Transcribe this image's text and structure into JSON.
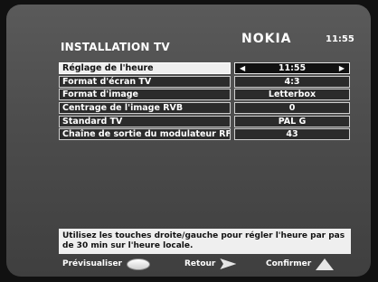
{
  "header": {
    "title": "INSTALLATION TV",
    "brand": "NOKIA",
    "time": "11:55"
  },
  "menu": {
    "rows": [
      {
        "label": "Réglage de l'heure",
        "value": "11:55",
        "selected": true
      },
      {
        "label": "Format d'écran TV",
        "value": "4:3"
      },
      {
        "label": "Format d'image",
        "value": "Letterbox"
      },
      {
        "label": "Centrage de l'image RVB",
        "value": "0"
      },
      {
        "label": "Standard TV",
        "value": "PAL G"
      },
      {
        "label": "Chaîne de sortie du modulateur RF",
        "value": "43"
      }
    ],
    "left_arrow": "◀",
    "right_arrow": "▶"
  },
  "help": {
    "text": "Utilisez les touches droite/gauche pour régler l'heure par pas de 30 min sur l'heure locale."
  },
  "footer": {
    "preview_label": "Prévisualiser",
    "back_label": "Retour",
    "confirm_label": "Confirmer"
  },
  "icons": {
    "preview": "oval-button-icon",
    "back": "arrow-button-icon",
    "confirm": "triangle-button-icon"
  }
}
